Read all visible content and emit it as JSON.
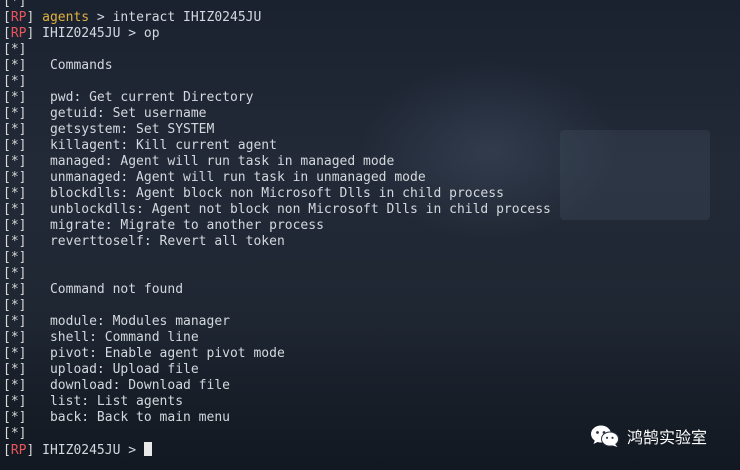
{
  "terminal": {
    "lines": [
      {
        "prefix": "[*]",
        "text": ""
      },
      {
        "prefix": "RP",
        "context": "agents",
        "text": " > interact IHIZ0245JU"
      },
      {
        "prefix": "RP",
        "context": "",
        "text": " IHIZ0245JU > op"
      },
      {
        "prefix": "[*]",
        "text": ""
      },
      {
        "prefix": "[*]",
        "text": "   Commands"
      },
      {
        "prefix": "[*]",
        "text": ""
      },
      {
        "prefix": "[*]",
        "text": "   pwd: Get current Directory"
      },
      {
        "prefix": "[*]",
        "text": "   getuid: Set username"
      },
      {
        "prefix": "[*]",
        "text": "   getsystem: Set SYSTEM"
      },
      {
        "prefix": "[*]",
        "text": "   killagent: Kill current agent"
      },
      {
        "prefix": "[*]",
        "text": "   managed: Agent will run task in managed mode"
      },
      {
        "prefix": "[*]",
        "text": "   unmanaged: Agent will run task in unmanaged mode"
      },
      {
        "prefix": "[*]",
        "text": "   blockdlls: Agent block non Microsoft Dlls in child process"
      },
      {
        "prefix": "[*]",
        "text": "   unblockdlls: Agent not block non Microsoft Dlls in child process"
      },
      {
        "prefix": "[*]",
        "text": "   migrate: Migrate to another process"
      },
      {
        "prefix": "[*]",
        "text": "   reverttoself: Revert all token"
      },
      {
        "prefix": "[*]",
        "text": ""
      },
      {
        "prefix": "[*]",
        "text": ""
      },
      {
        "prefix": "[*]",
        "text": "   Command not found"
      },
      {
        "prefix": "[*]",
        "text": ""
      },
      {
        "prefix": "[*]",
        "text": "   module: Modules manager"
      },
      {
        "prefix": "[*]",
        "text": "   shell: Command line"
      },
      {
        "prefix": "[*]",
        "text": "   pivot: Enable agent pivot mode"
      },
      {
        "prefix": "[*]",
        "text": "   upload: Upload file"
      },
      {
        "prefix": "[*]",
        "text": "   download: Download file"
      },
      {
        "prefix": "[*]",
        "text": "   list: List agents"
      },
      {
        "prefix": "[*]",
        "text": "   back: Back to main menu"
      },
      {
        "prefix": "[*]",
        "text": ""
      },
      {
        "prefix": "RP",
        "context": "",
        "text": " IHIZ0245JU > ",
        "cursor": true
      }
    ]
  },
  "watermark": {
    "icon": "wechat-icon",
    "text": "鸿鹄实验室"
  },
  "colors": {
    "rp": "#e8555a",
    "agents_context": "#e0b03f",
    "text": "#d4d8de",
    "cursor": "#e8e8e8"
  }
}
